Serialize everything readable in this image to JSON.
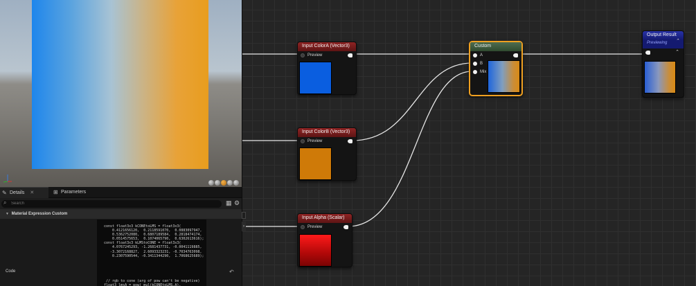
{
  "nodes": {
    "color_a": {
      "title": "Input ColorA (Vector3)",
      "pin_preview": "Preview",
      "swatch_color": "#0a5ee0"
    },
    "color_b": {
      "title": "Input ColorB (Vector3)",
      "pin_preview": "Preview",
      "swatch_color": "#cf7a08"
    },
    "alpha": {
      "title": "Input Alpha (Scalar)",
      "pin_preview": "Preview",
      "swatch_color": "#d01010"
    },
    "custom": {
      "title": "Custom",
      "pin_a": "A",
      "pin_b": "B",
      "pin_mix": "Mix",
      "highlight_color": "#f0a020"
    },
    "output": {
      "title": "Output Result",
      "subtitle": "Previewing"
    }
  },
  "viewport": {
    "gradient_left": "#1e86ec",
    "gradient_right": "#e89d1e"
  },
  "tabs": [
    {
      "label": "Details",
      "icon": "pencil-icon"
    },
    {
      "label": "Parameters",
      "icon": "parameters-icon"
    }
  ],
  "search": {
    "placeholder": "Search"
  },
  "details": {
    "category": "Material Expression Custom",
    "code_label": "Code",
    "code_text": "const float3x3 kCONEtoLMS = float3x3(\n    0.4121656120,  0.2118591070,  0.0883097947,\n    0.5362752080,  0.6807189584,  0.2818474174,\n    0.0514575653,  0.1074065790,  0.6302613616);\nconst float3x3 kLMStoCONE = float3x3(\n    4.0767245293, -1.2681437731, -0.0041119885,\n   -3.3072168827,  2.6093323231, -0.7034763098,\n    0.2307590544, -0.3411344290,  1.7068625689);\n\n\n\n\n\n // rgb to cone (arg of pow can't be negative)\nfloat3 lmsA = pow( mul(kCONEtoLMS,A),"
  }
}
